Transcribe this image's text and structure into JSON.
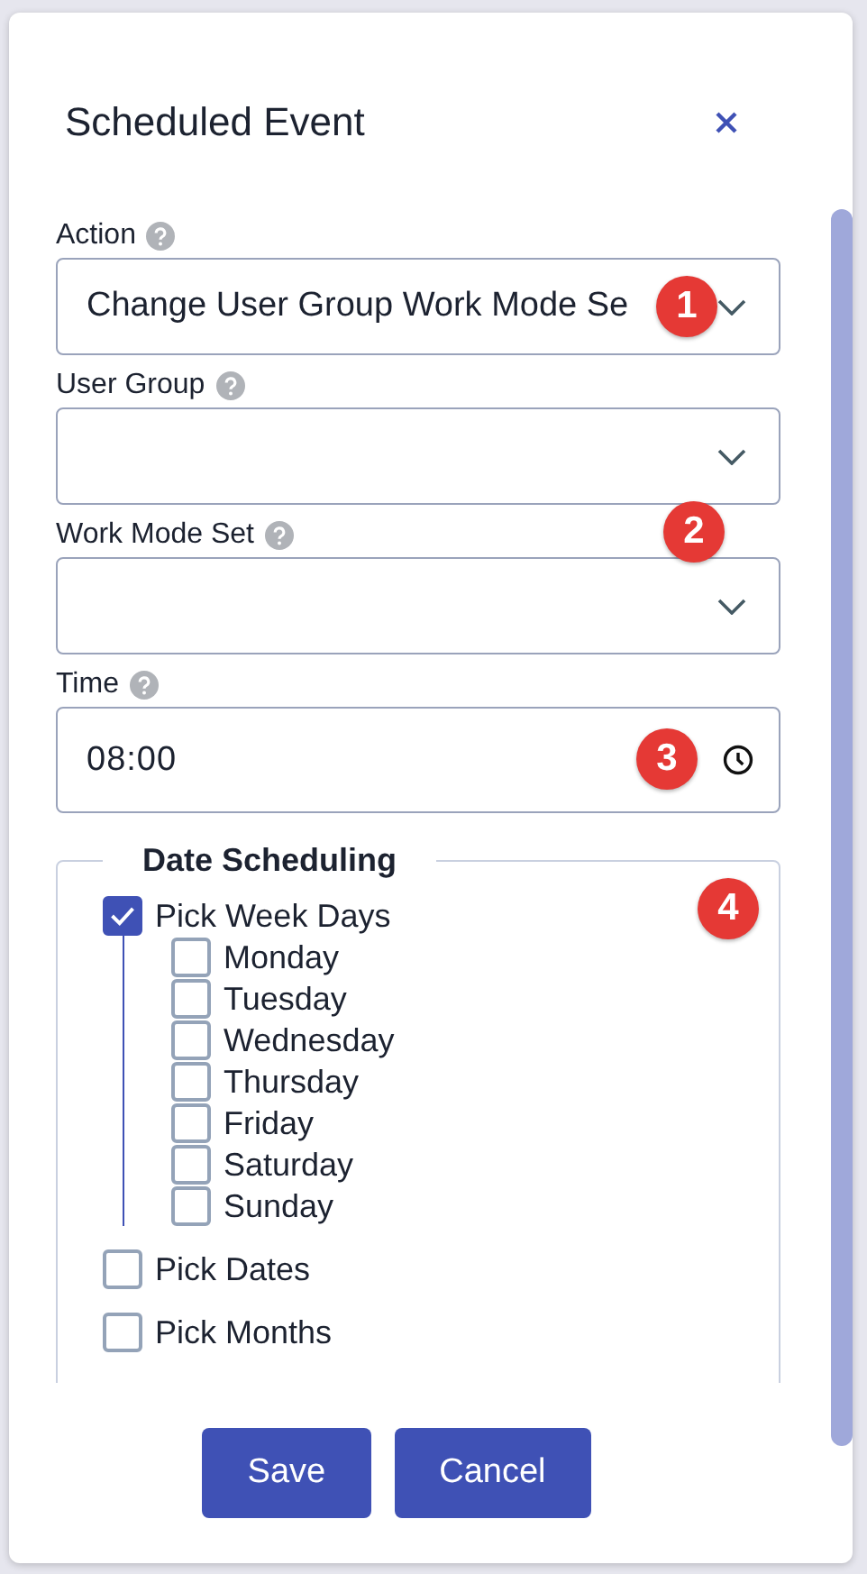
{
  "dialog": {
    "title": "Scheduled Event"
  },
  "fields": [
    {
      "label": "Action",
      "kind": "select",
      "value": "Change User Group Work Mode Se"
    },
    {
      "label": "User Group",
      "kind": "select"
    },
    {
      "label": "Work Mode Set",
      "kind": "select"
    },
    {
      "label": "Time",
      "kind": "time",
      "value": "08:00"
    }
  ],
  "date_scheduling": {
    "title": "Date Scheduling",
    "options": [
      {
        "label": "Pick Week Days",
        "checked": true,
        "children": [
          {
            "label": "Monday",
            "checked": false
          },
          {
            "label": "Tuesday",
            "checked": false
          },
          {
            "label": "Wednesday",
            "checked": false
          },
          {
            "label": "Thursday",
            "checked": false
          },
          {
            "label": "Friday",
            "checked": false
          },
          {
            "label": "Saturday",
            "checked": false
          },
          {
            "label": "Sunday",
            "checked": false
          }
        ]
      },
      {
        "label": "Pick Dates",
        "checked": false
      },
      {
        "label": "Pick Months",
        "checked": false
      }
    ]
  },
  "buttons": [
    "Save",
    "Cancel"
  ],
  "annotations": [
    "1",
    "2",
    "3",
    "4"
  ]
}
